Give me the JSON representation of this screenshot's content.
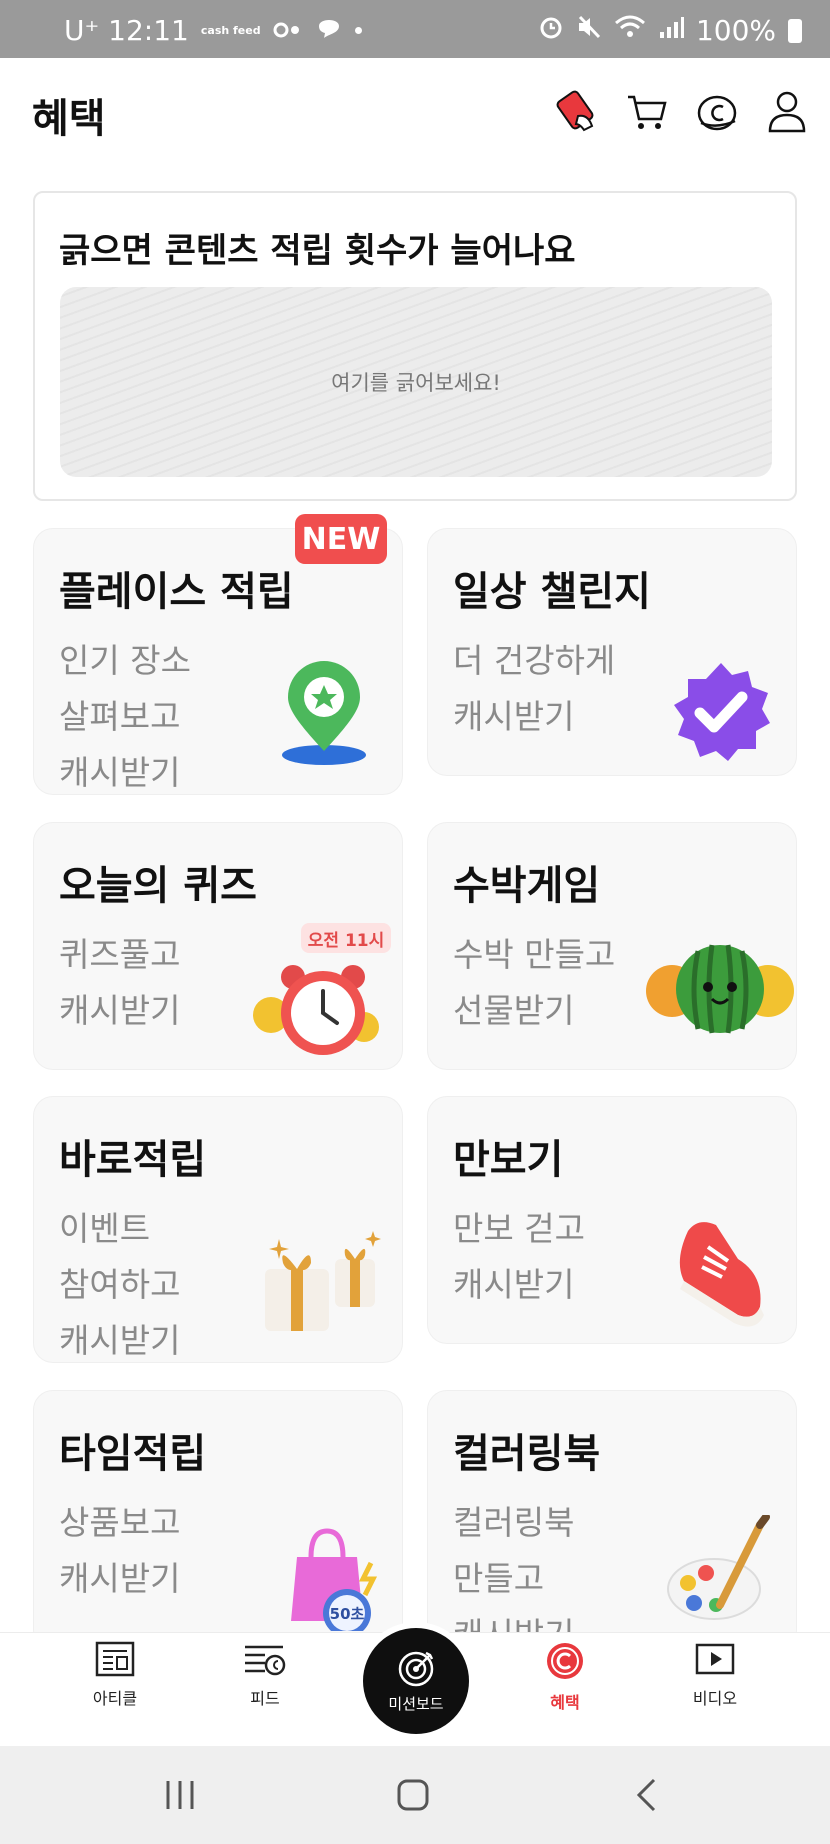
{
  "status_bar": {
    "carrier_time": "U⁺ 12:11",
    "app_badge": "cash feed",
    "battery": "100%"
  },
  "header": {
    "title": "혜택",
    "icons": [
      "coupon-icon",
      "cart-icon",
      "cash-icon",
      "profile-icon"
    ]
  },
  "scratch": {
    "title": "긁으면 콘텐츠 적립 횟수가 늘어나요",
    "hint": "여기를 긁어보세요!"
  },
  "cards": [
    {
      "title": "플레이스 적립",
      "desc": "인기 장소\n살펴보고\n캐시받기",
      "badge": "NEW",
      "icon": "map-pin-icon"
    },
    {
      "title": "일상 챌린지",
      "desc": "더 건강하게\n캐시받기",
      "icon": "verified-badge-icon"
    },
    {
      "title": "오늘의 퀴즈",
      "desc": "퀴즈풀고\n캐시받기",
      "badge": "오전 11시",
      "icon": "alarm-clock-icon"
    },
    {
      "title": "수박게임",
      "desc": "수박 만들고\n선물받기",
      "icon": "watermelon-icon"
    },
    {
      "title": "바로적립",
      "desc": "이벤트\n참여하고\n캐시받기",
      "icon": "gift-boxes-icon"
    },
    {
      "title": "만보기",
      "desc": "만보 걷고\n캐시받기",
      "icon": "sneaker-icon"
    },
    {
      "title": "타임적립",
      "desc": "상품보고\n캐시받기",
      "badge": "50초",
      "icon": "shopping-bag-icon"
    },
    {
      "title": "컬러링북",
      "desc": "컬러링북\n만들고\n캐시받기",
      "icon": "paint-palette-icon"
    }
  ],
  "bottom_nav": {
    "items": [
      {
        "label": "아티클",
        "icon": "article-icon"
      },
      {
        "label": "피드",
        "icon": "feed-icon"
      },
      {
        "label": "미션보드",
        "icon": "target-icon"
      },
      {
        "label": "혜택",
        "icon": "benefit-coin-icon",
        "active": true
      },
      {
        "label": "비디오",
        "icon": "video-play-icon"
      }
    ]
  },
  "colors": {
    "accent": "#e8383d",
    "new_badge": "#f04e4e",
    "card_bg": "#f8f8f8",
    "status_bar": "#9a9a9a"
  }
}
